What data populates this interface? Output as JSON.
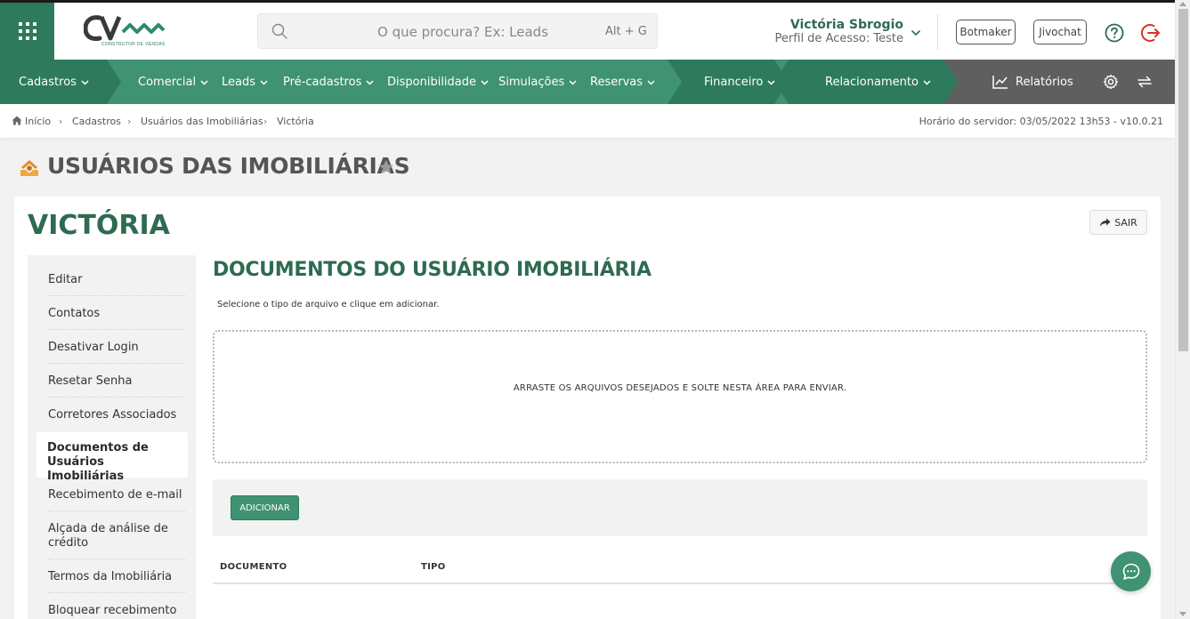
{
  "header": {
    "logo_tagline": "CONSTRUTOR DE VENDAS",
    "search_placeholder": "O que procura? Ex: Leads",
    "search_shortcut": "Alt + G",
    "user_name": "Victória Sbrogio",
    "user_profile": "Perfil de Acesso: Teste",
    "botmaker_label": "Botmaker",
    "jivochat_label": "Jivochat",
    "icons": [
      "apps-grid-icon",
      "search-icon",
      "chevron-down-icon",
      "help-icon",
      "logout-icon"
    ]
  },
  "nav": {
    "items": [
      {
        "label": "Cadastros"
      },
      {
        "label": "Comercial"
      },
      {
        "label": "Leads"
      },
      {
        "label": "Pré-cadastros"
      },
      {
        "label": "Disponibilidade"
      },
      {
        "label": "Simulações"
      },
      {
        "label": "Reservas"
      },
      {
        "label": "Financeiro"
      },
      {
        "label": "Relacionamento"
      },
      {
        "label": "Relatórios"
      }
    ],
    "colors": {
      "base": "#3f9272",
      "dark": "#2e7a5c",
      "grey": "#5f5f5f"
    }
  },
  "breadcrumb": {
    "items": [
      "Início",
      "Cadastros",
      "Usuários das Imobiliárias",
      "Victória"
    ],
    "server_time": "Horário do servidor: 03/05/2022 13h53 - v10.0.21"
  },
  "page": {
    "title": "USUÁRIOS DAS IMOBILIÁRIAS",
    "record_name": "VICTÓRIA",
    "exit_label": "SAIR"
  },
  "sidemenu": {
    "items": [
      {
        "label": "Editar"
      },
      {
        "label": "Contatos"
      },
      {
        "label": "Desativar Login"
      },
      {
        "label": "Resetar Senha"
      },
      {
        "label": "Corretores Associados"
      },
      {
        "label": "Documentos de Usuários Imobiliárias",
        "active": true
      },
      {
        "label": "Recebimento de e-mail"
      },
      {
        "label": "Alçada de análise de crédito"
      },
      {
        "label": "Termos da Imobiliária"
      },
      {
        "label": "Bloquear recebimento"
      }
    ]
  },
  "main": {
    "title": "DOCUMENTOS DO USUÁRIO IMOBILIÁRIA",
    "hint": "Selecione o tipo de arquivo e clique em adicionar.",
    "dropzone_text": "ARRASTE OS ARQUIVOS DESEJADOS E SOLTE NESTA ÁREA PARA ENVIAR.",
    "add_label": "ADICIONAR",
    "table_headers": [
      "DOCUMENTO",
      "TIPO"
    ]
  },
  "colors": {
    "brand_green": "#2e6b50",
    "accent_green": "#3f9272",
    "logout_red": "#d9331f"
  }
}
